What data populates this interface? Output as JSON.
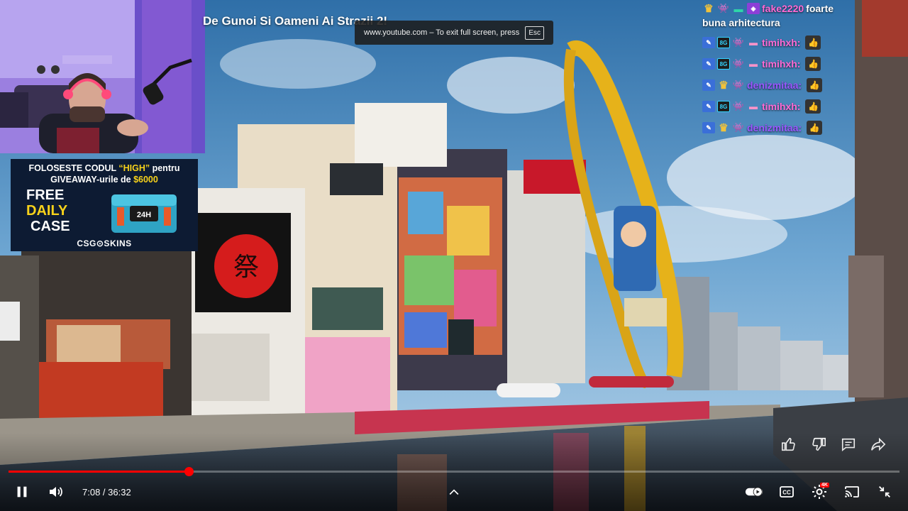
{
  "video": {
    "title": "De Gunoi Si Oameni Ai Strazii 2!",
    "progress": 0.202
  },
  "fullscreen_toast": {
    "text": "www.youtube.com – To exit full screen, press",
    "key": "Esc"
  },
  "ad": {
    "line1_a": "FOLOSESTE CODUL ",
    "line1_code": "“HIGH”",
    "line1_b": " pentru",
    "line2_a": "GIVEAWAY-urile de ",
    "line2_amount": "$6000",
    "free": "FREE",
    "daily": "DAILY",
    "case": "CASE",
    "brand": "CSG⊙SKINS",
    "box_label": "24H"
  },
  "chat": {
    "messages": [
      {
        "user": "fake2220",
        "color": "#ff6ad5",
        "text": "foarte",
        "badges": [
          "crown-icon",
          "alien-icon",
          "teal-icon",
          "purple-icon"
        ]
      },
      {
        "user": "",
        "color": "#ffffff",
        "text": "buna arhitectura",
        "badges": []
      },
      {
        "user": "timihxh:",
        "color": "#ff6ad5",
        "text": "",
        "badges": [
          "wrench-icon",
          "8g-icon",
          "alien-icon",
          "pink-icon"
        ]
      },
      {
        "user": "timihxh:",
        "color": "#ff6ad5",
        "text": "",
        "badges": [
          "wrench-icon",
          "8g-icon",
          "alien-icon",
          "pink-icon"
        ]
      },
      {
        "user": "denizmitaa:",
        "color": "#9a56ff",
        "text": "",
        "badges": [
          "wrench-icon",
          "crown-icon",
          "alien-icon"
        ]
      },
      {
        "user": "timihxh:",
        "color": "#ff6ad5",
        "text": "",
        "badges": [
          "wrench-icon",
          "8g-icon",
          "alien-icon",
          "pink-icon"
        ]
      },
      {
        "user": "denizmitaa:",
        "color": "#9a56ff",
        "text": "",
        "badges": [
          "wrench-icon",
          "crown-icon",
          "alien-icon"
        ]
      }
    ]
  },
  "player": {
    "time_current": "7:08",
    "time_total": "36:32",
    "time_display": "7:08 / 36:32",
    "settings_badge": "4K"
  },
  "colors": {
    "progress": "#ff0000",
    "accent_yellow": "#f7d21a"
  }
}
